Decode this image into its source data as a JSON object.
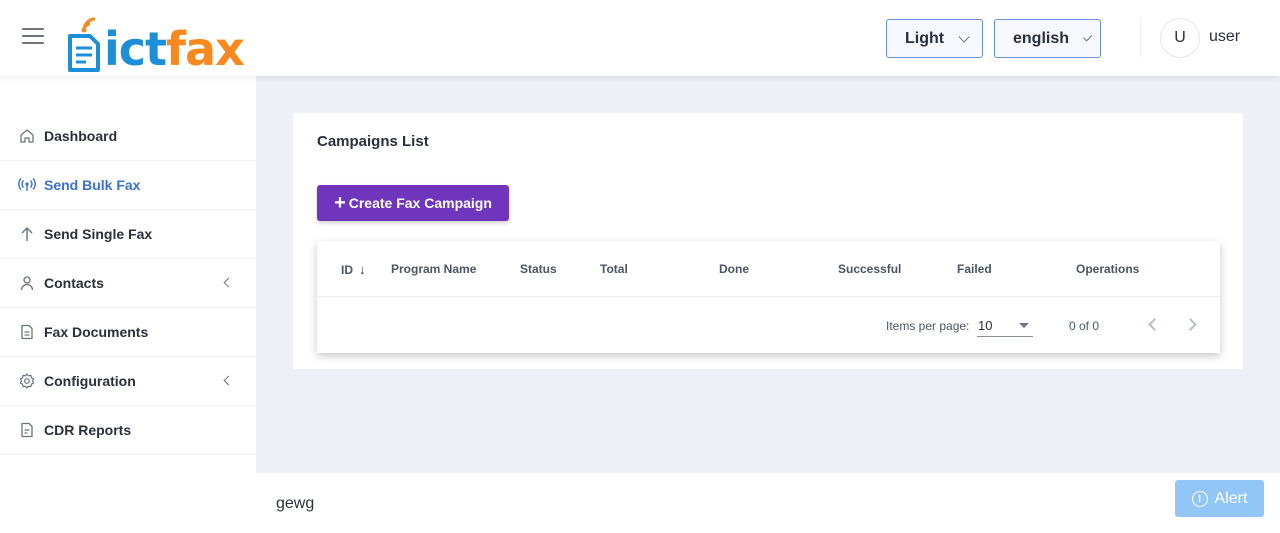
{
  "header": {
    "logo": {
      "part1": "ict",
      "part2": "fax",
      "color1": "#1c8fd8",
      "color2": "#f7891f"
    },
    "theme_select": {
      "value": "Light"
    },
    "language_select": {
      "value": "english"
    },
    "user": {
      "avatar_initial": "U",
      "name": "user"
    }
  },
  "sidebar": {
    "items": [
      {
        "label": "Dashboard",
        "icon": "home-icon",
        "active": false,
        "expandable": false
      },
      {
        "label": "Send Bulk Fax",
        "icon": "broadcast-icon",
        "active": true,
        "expandable": false
      },
      {
        "label": "Send Single Fax",
        "icon": "arrow-up-icon",
        "active": false,
        "expandable": false
      },
      {
        "label": "Contacts",
        "icon": "user-icon",
        "active": false,
        "expandable": true
      },
      {
        "label": "Fax Documents",
        "icon": "document-icon",
        "active": false,
        "expandable": false
      },
      {
        "label": "Configuration",
        "icon": "gear-icon",
        "active": false,
        "expandable": true
      },
      {
        "label": "CDR Reports",
        "icon": "report-icon",
        "active": false,
        "expandable": false
      }
    ]
  },
  "main": {
    "title": "Campaigns List",
    "create_button": "Create Fax Campaign",
    "accent_color": "#6f36bd",
    "table": {
      "columns": [
        "ID",
        "Program Name",
        "Status",
        "Total",
        "Done",
        "Successful",
        "Failed",
        "Operations"
      ],
      "rows": [],
      "sorted_column": "ID",
      "sort_direction": "desc"
    },
    "paginator": {
      "items_per_page_label": "Items per page:",
      "items_per_page": "10",
      "range_label": "0 of 0"
    }
  },
  "footer": {
    "text": "gewg",
    "alert_button": "Alert"
  }
}
